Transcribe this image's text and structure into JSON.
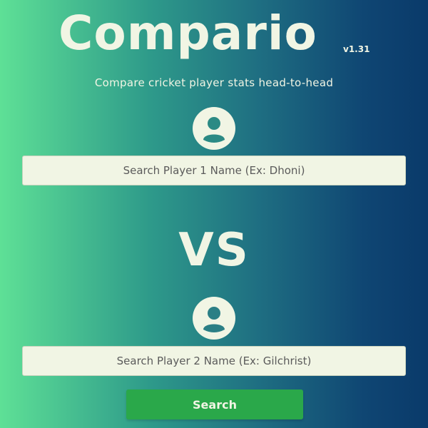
{
  "header": {
    "title": "Compario",
    "version": "v1.31",
    "subtitle": "Compare cricket player stats head-to-head"
  },
  "player1": {
    "icon": "user-circle-icon",
    "placeholder": "Search Player 1 Name (Ex: Dhoni)",
    "value": ""
  },
  "versus": {
    "label": "VS"
  },
  "player2": {
    "icon": "user-circle-icon",
    "placeholder": "Search Player 2 Name (Ex: Gilchrist)",
    "value": ""
  },
  "actions": {
    "search_label": "Search"
  },
  "colors": {
    "gradient_start": "#5ee096",
    "gradient_end": "#0a3a6a",
    "text_light": "#f1f5e4",
    "button_green": "#2aa84a"
  }
}
